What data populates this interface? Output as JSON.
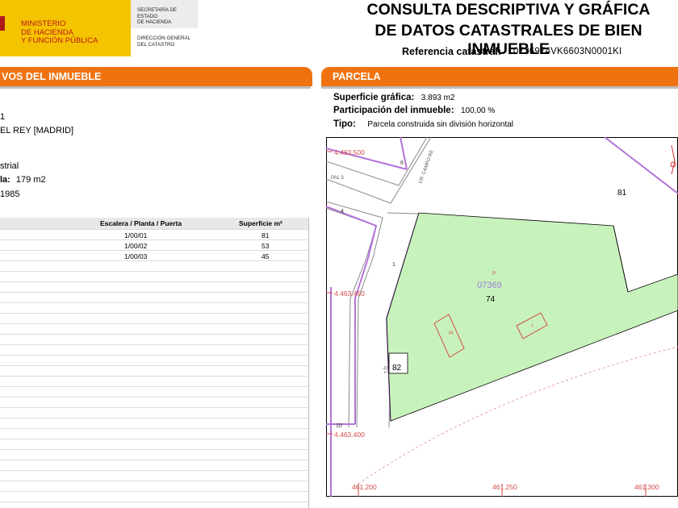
{
  "header": {
    "ministry_lines": [
      "MINISTERIO",
      "DE HACIENDA",
      "Y FUNCIÓN PÚBLICA"
    ],
    "secretaria_lines": [
      "SECRETARÍA DE ESTADO",
      "DE HACIENDA"
    ],
    "direccion_lines": [
      "DIRECCIÓN GENERAL",
      "DEL CATASTRO"
    ],
    "title_line1": "CONSULTA DESCRIPTIVA Y GRÁFICA",
    "title_line2": "DE DATOS CATASTRALES DE BIEN INMUEBLE",
    "ref_label": "Referencia catastral:",
    "ref_value": "0736974VK6603N0001KI"
  },
  "left": {
    "section_title": "VOS DEL INMUEBLE",
    "line_a": "1",
    "line_b": "EL REY [MADRID]",
    "line_c": "strial",
    "line_d_label": "la:",
    "line_d_value": "179 m2",
    "line_e": "1985",
    "table": {
      "headers": [
        "Escalera / Planta / Puerta",
        "Superficie m²"
      ],
      "rows": [
        [
          "1/00/01",
          "81"
        ],
        [
          "1/00/02",
          "53"
        ],
        [
          "1/00/03",
          "45"
        ]
      ]
    }
  },
  "right": {
    "section_title": "PARCELA",
    "superficie_label": "Superficie gráfica:",
    "superficie_value": "3.893 m2",
    "participacion_label": "Participación del inmueble:",
    "participacion_value": "100,00 %",
    "tipo_label": "Tipo:",
    "tipo_value": "Parcela construida sin división horizontal"
  },
  "map": {
    "y_coords": [
      "4.463.500",
      "4.463.450",
      "4.463.400"
    ],
    "x_coords": [
      "461.200",
      "461.250",
      "461.300"
    ],
    "parcel_code": "07369",
    "parcel_letter": "P",
    "parcel_number": "74",
    "neighbor_81": "81",
    "neighbor_82": "82",
    "street_name": "CR. CAMPO RE",
    "street_num_6": "6",
    "street_num_4": "4",
    "street_num_1": "1",
    "street_num_10": "10",
    "small_label_pal": "PAL 3",
    "small_label_ql": "Q L",
    "building_pi": "PI",
    "building_i": "I"
  }
}
